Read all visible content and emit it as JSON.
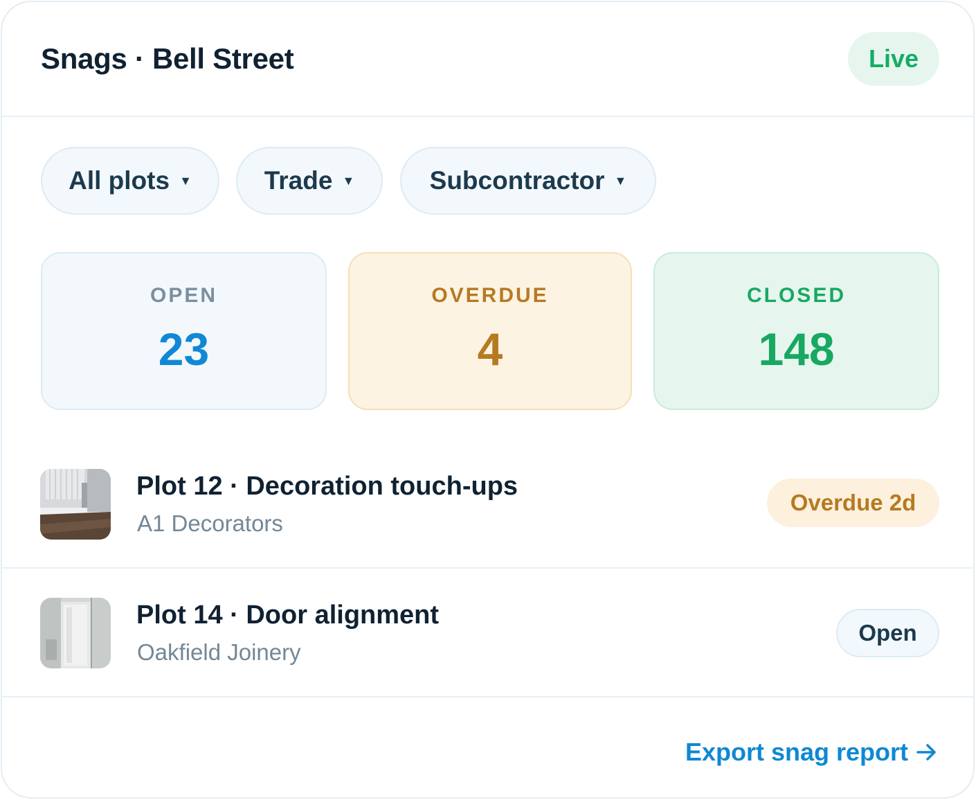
{
  "header": {
    "title": "Snags · Bell Street",
    "status_badge": "Live"
  },
  "filters": [
    {
      "label": "All plots"
    },
    {
      "label": "Trade"
    },
    {
      "label": "Subcontractor"
    }
  ],
  "stats": {
    "open": {
      "label": "OPEN",
      "value": "23"
    },
    "overdue": {
      "label": "OVERDUE",
      "value": "4"
    },
    "closed": {
      "label": "CLOSED",
      "value": "148"
    }
  },
  "snags": [
    {
      "title": "Plot 12 · Decoration touch-ups",
      "subcontractor": "A1 Decorators",
      "status": "Overdue 2d",
      "thumbnail_icon": "skirting-photo"
    },
    {
      "title": "Plot 14 · Door alignment",
      "subcontractor": "Oakfield Joinery",
      "status": "Open",
      "thumbnail_icon": "door-photo"
    }
  ],
  "footer": {
    "export_label": "Export snag report"
  },
  "colors": {
    "accent": "#0e88d4",
    "success": "#17a862",
    "warning": "#b57a22"
  }
}
